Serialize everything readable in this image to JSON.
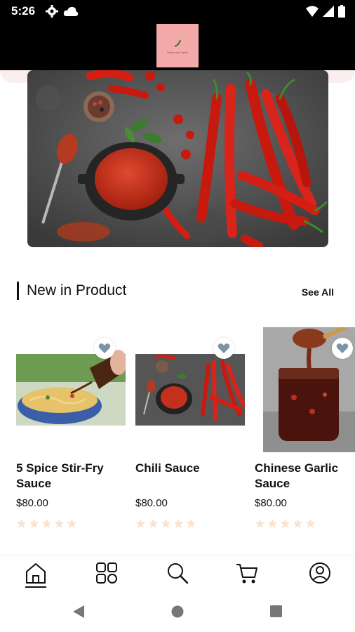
{
  "status_bar": {
    "time": "5:26"
  },
  "header": {
    "logo_text": "Sauce and Spice"
  },
  "section": {
    "title": "New in Product",
    "see_all": "See All"
  },
  "products": [
    {
      "name": "5 Spice Stir-Fry Sauce",
      "price": "$80.00",
      "rating": 0
    },
    {
      "name": "Chili Sauce",
      "price": "$80.00",
      "rating": 0
    },
    {
      "name": "Chinese Garlic Sauce",
      "price": "$80.00",
      "rating": 0
    }
  ],
  "colors": {
    "star": "#fbe3cf",
    "heart": "#7b95a5",
    "logo_bg": "#f2a9a8",
    "header_bg": "#000000"
  },
  "bottom_nav": [
    "home-icon",
    "categories-icon",
    "search-icon",
    "cart-icon",
    "profile-icon"
  ]
}
